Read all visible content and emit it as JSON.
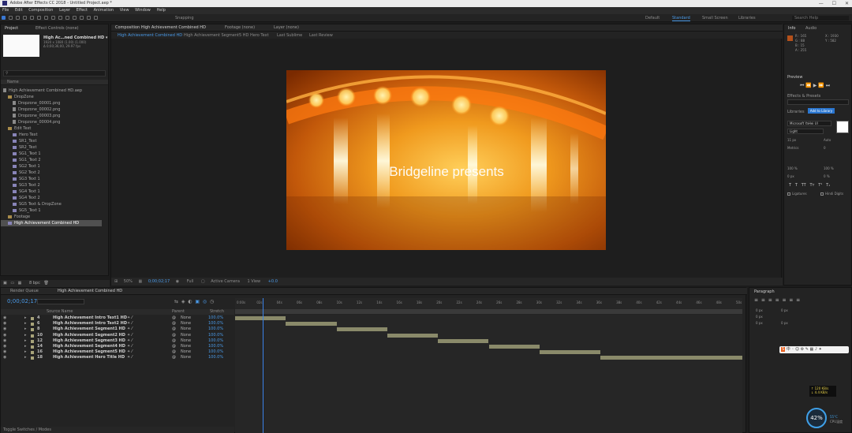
{
  "window": {
    "title": "Adobe After Effects CC 2018 - Untitled Project.aep *"
  },
  "menu": [
    "File",
    "Edit",
    "Composition",
    "Layer",
    "Effect",
    "Animation",
    "View",
    "Window",
    "Help"
  ],
  "toolbar": {
    "snapping": "Snapping",
    "workspaces": [
      "Default",
      "Standard",
      "Small Screen",
      "Libraries"
    ],
    "active_workspace": "Standard",
    "search_placeholder": "Search Help"
  },
  "project": {
    "tabs": [
      "Project",
      "Effect Controls (none)"
    ],
    "selected_name": "High Ac…ned Combined HD ▾",
    "selected_info": [
      "1920 x 1080 (1.00) (1.000)",
      "Δ 0;00;36;00, 29.97 fps"
    ],
    "search_placeholder": "",
    "name_header": "Name",
    "items": [
      {
        "label": "High Achievement Combined HD.aep",
        "type": "file",
        "indent": 0
      },
      {
        "label": "DropZone",
        "type": "folder",
        "indent": 1
      },
      {
        "label": "Dropzone_00001.png",
        "type": "file",
        "indent": 2
      },
      {
        "label": "Dropzone_00002.png",
        "type": "file",
        "indent": 2
      },
      {
        "label": "Dropzone_00003.png",
        "type": "file",
        "indent": 2
      },
      {
        "label": "Dropzone_00004.png",
        "type": "file",
        "indent": 2
      },
      {
        "label": "Edit Text",
        "type": "folder",
        "indent": 1
      },
      {
        "label": "Hero Text",
        "type": "comp",
        "indent": 2
      },
      {
        "label": "SR1_Text",
        "type": "comp",
        "indent": 2
      },
      {
        "label": "SR2_Text",
        "type": "comp",
        "indent": 2
      },
      {
        "label": "SG1_Text 1",
        "type": "comp",
        "indent": 2
      },
      {
        "label": "SG1_Text 2",
        "type": "comp",
        "indent": 2
      },
      {
        "label": "SG2 Text 1",
        "type": "comp",
        "indent": 2
      },
      {
        "label": "SG2 Text 2",
        "type": "comp",
        "indent": 2
      },
      {
        "label": "SG3 Text 1",
        "type": "comp",
        "indent": 2
      },
      {
        "label": "SG3 Text 2",
        "type": "comp",
        "indent": 2
      },
      {
        "label": "SG4 Text 1",
        "type": "comp",
        "indent": 2
      },
      {
        "label": "SG4 Text 2",
        "type": "comp",
        "indent": 2
      },
      {
        "label": "SG5 Text & DropZone",
        "type": "comp",
        "indent": 2
      },
      {
        "label": "SG5_Text 1",
        "type": "comp",
        "indent": 2
      },
      {
        "label": "Footage",
        "type": "folder",
        "indent": 1
      },
      {
        "label": "High Achievement Combined HD",
        "type": "comp",
        "indent": 1,
        "selected": true
      }
    ],
    "footer_bpc": "8 bpc"
  },
  "composition": {
    "tabs": [
      "Composition High Achievement Combined HD",
      "Footage (none)",
      "Layer (none)"
    ],
    "crumbs": [
      "High Achievement Combined HD",
      "High Achievement Segment5 HD",
      "Hero Text",
      "Last Sublime",
      "Last Review"
    ],
    "title_text": "Bridgeline presents",
    "footer": {
      "zoom": "50%",
      "timecode": "0;00;02;17",
      "resolution": "Full",
      "camera": "Active Camera",
      "views": "1 View",
      "offset": "+0.0"
    }
  },
  "info": {
    "tabs": [
      "Info",
      "Audio"
    ],
    "values": [
      "R : 165",
      "G : 88",
      "B : 15",
      "A : 255"
    ],
    "coords": [
      "X : 1930",
      "Y : 582"
    ],
    "swatch": "#b4501a"
  },
  "preview": {
    "label": "Preview"
  },
  "effects": {
    "label": "Effects & Presets"
  },
  "libraries": {
    "label": "Libraries",
    "button": "Add to Library"
  },
  "character": {
    "font": "Microsoft YaHei UI",
    "style": "Light",
    "size": "11 px",
    "leading": "Auto",
    "tracking": "0",
    "kerning": "Metrics",
    "scale_v": "100 %",
    "scale_h": "100 %",
    "baseline": "0 px",
    "tsume": "0 %",
    "ligatures": "Ligatures",
    "hindi": "Hindi Digits"
  },
  "timeline": {
    "tabs": [
      "Render Queue",
      "High Achievement Combined HD"
    ],
    "timecode": "0;00;02;17",
    "columns": {
      "layer_name": "Source Name",
      "parent": "Parent",
      "mode": "Stretch"
    },
    "ruler": [
      "0:00s",
      "02s",
      "04s",
      "06s",
      "08s",
      "10s",
      "12s",
      "14s",
      "16s",
      "18s",
      "20s",
      "22s",
      "24s",
      "26s",
      "28s",
      "30s",
      "32s",
      "34s",
      "36s",
      "38s",
      "40s",
      "42s",
      "44s",
      "46s",
      "48s",
      "50s"
    ],
    "layers": [
      {
        "num": "4",
        "name": "High Achievement Intro Text1 HD",
        "parent": "None",
        "stretch": "100.0%",
        "start": 0.0,
        "end": 0.1
      },
      {
        "num": "6",
        "name": "High Achievement Intro Text2 HD",
        "parent": "None",
        "stretch": "100.0%",
        "start": 0.1,
        "end": 0.2
      },
      {
        "num": "8",
        "name": "High Achievement Segment1 HD",
        "parent": "None",
        "stretch": "100.0%",
        "start": 0.2,
        "end": 0.3
      },
      {
        "num": "10",
        "name": "High Achievement Segment2 HD",
        "parent": "None",
        "stretch": "100.0%",
        "start": 0.3,
        "end": 0.4
      },
      {
        "num": "12",
        "name": "High Achievement Segment3 HD",
        "parent": "None",
        "stretch": "100.0%",
        "start": 0.4,
        "end": 0.5
      },
      {
        "num": "14",
        "name": "High Achievement Segment4 HD",
        "parent": "None",
        "stretch": "100.0%",
        "start": 0.5,
        "end": 0.6
      },
      {
        "num": "16",
        "name": "High Achievement Segment5 HD",
        "parent": "None",
        "stretch": "100.0%",
        "start": 0.6,
        "end": 0.72
      },
      {
        "num": "18",
        "name": "High Achievement Hero Title HD",
        "parent": "None",
        "stretch": "100.0%",
        "start": 0.72,
        "end": 1.0
      }
    ],
    "playhead": 0.054,
    "footer": "Toggle Switches / Modes"
  },
  "paragraph": {
    "label": "Paragraph",
    "fields": [
      "0 px",
      "0 px",
      "0 px",
      "0 px",
      "0 px"
    ]
  },
  "network": {
    "up": "↑ 120 KB/s",
    "down": "↓ 4.4 KB/s"
  },
  "meter": {
    "value": "42%",
    "temp": "55°C",
    "cpu": "CPU温度"
  }
}
